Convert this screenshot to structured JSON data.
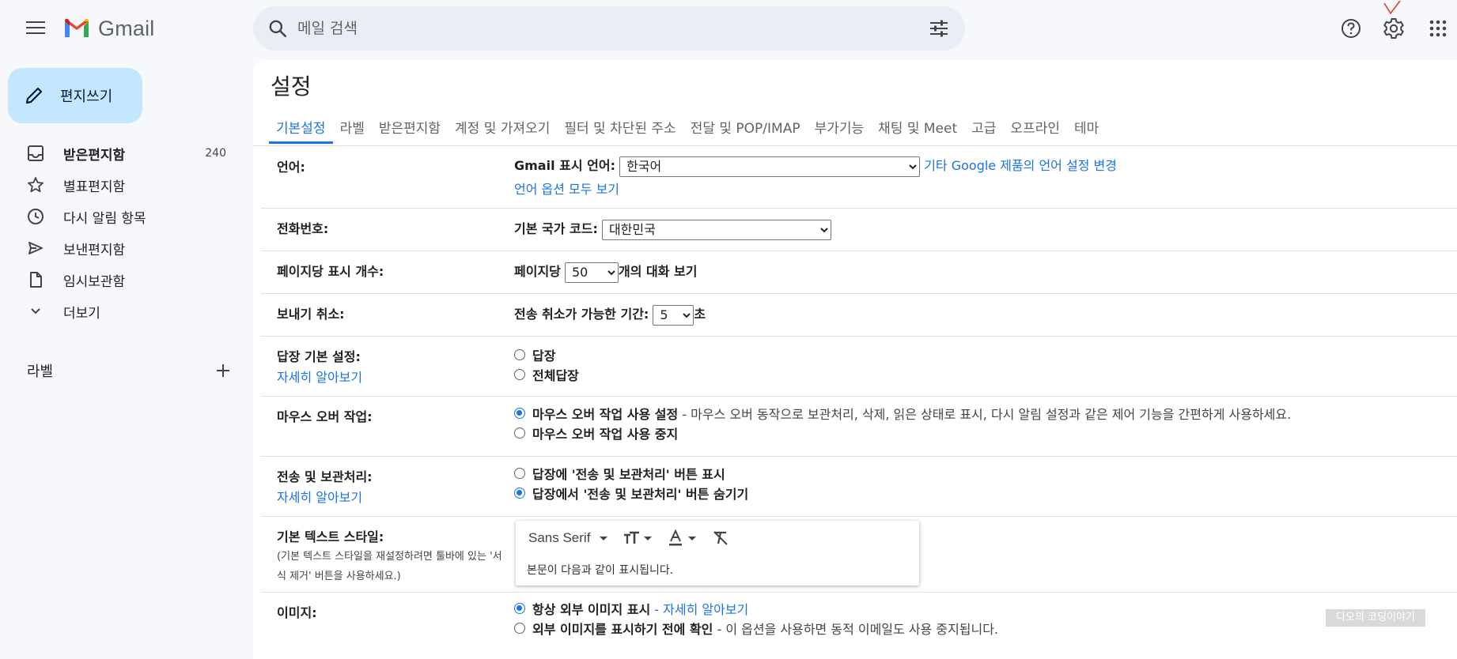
{
  "header": {
    "app_name": "Gmail",
    "search_placeholder": "메일 검색"
  },
  "sidebar": {
    "compose_label": "편지쓰기",
    "items": [
      {
        "label": "받은편지함",
        "count": "240",
        "icon": "inbox-icon"
      },
      {
        "label": "별표편지함",
        "icon": "star-icon"
      },
      {
        "label": "다시 알림 항목",
        "icon": "clock-icon"
      },
      {
        "label": "보낸편지함",
        "icon": "send-icon"
      },
      {
        "label": "임시보관함",
        "icon": "draft-icon"
      },
      {
        "label": "더보기",
        "icon": "chevron-down-icon"
      }
    ],
    "labels_heading": "라벨"
  },
  "settings": {
    "title": "설정",
    "tabs": [
      "기본설정",
      "라벨",
      "받은편지함",
      "계정 및 가져오기",
      "필터 및 차단된 주소",
      "전달 및 POP/IMAP",
      "부가기능",
      "채팅 및 Meet",
      "고급",
      "오프라인",
      "테마"
    ],
    "active_tab": "기본설정",
    "language": {
      "label": "언어:",
      "display_label": "Gmail 표시 언어:",
      "selected": "한국어",
      "other_products_link": "기타 Google 제품의 언어 설정 변경",
      "show_all_link": "언어 옵션 모두 보기"
    },
    "phone": {
      "label": "전화번호:",
      "country_label": "기본 국가 코드:",
      "selected": "대한민국"
    },
    "page_size": {
      "label": "페이지당 표시 개수:",
      "prefix": "페이지당",
      "selected": "50",
      "suffix": "개의 대화 보기"
    },
    "undo_send": {
      "label": "보내기 취소:",
      "prefix": "전송 취소가 가능한 기간:",
      "selected": "5",
      "suffix": "초"
    },
    "reply": {
      "label": "답장 기본 설정:",
      "learn_more": "자세히 알아보기",
      "options": [
        "답장",
        "전체답장"
      ]
    },
    "hover": {
      "label": "마우스 오버 작업:",
      "option_on": "마우스 오버 작업 사용 설정",
      "option_on_desc": "- 마우스 오버 동작으로 보관처리, 삭제, 읽은 상태로 표시, 다시 알림 설정과 같은 제어 기능을 간편하게 사용하세요.",
      "option_off": "마우스 오버 작업 사용 중지"
    },
    "send_archive": {
      "label": "전송 및 보관처리:",
      "learn_more": "자세히 알아보기",
      "option_show": "답장에 '전송 및 보관처리' 버튼 표시",
      "option_hide": "답장에서 '전송 및 보관처리' 버튼 숨기기"
    },
    "text_style": {
      "label": "기본 텍스트 스타일:",
      "note": "(기본 텍스트 스타일을 재설정하려면 툴바에 있는 '서식 제거' 버튼을 사용하세요.)",
      "font": "Sans Serif",
      "preview": "본문이 다음과 같이 표시됩니다."
    },
    "images": {
      "label": "이미지:",
      "option_always": "항상 외부 이미지 표시",
      "option_always_link": "- 자세히 알아보기",
      "option_ask": "외부 이미지를 표시하기 전에 확인",
      "option_ask_desc": "- 이 옵션을 사용하면 동적 이메일도 사용 중지됩니다."
    }
  },
  "watermark": "다오의 코딩이야기",
  "colors": {
    "accent": "#1a73e8",
    "compose_bg": "#c2e7ff",
    "page_bg": "#f6f8fc"
  }
}
